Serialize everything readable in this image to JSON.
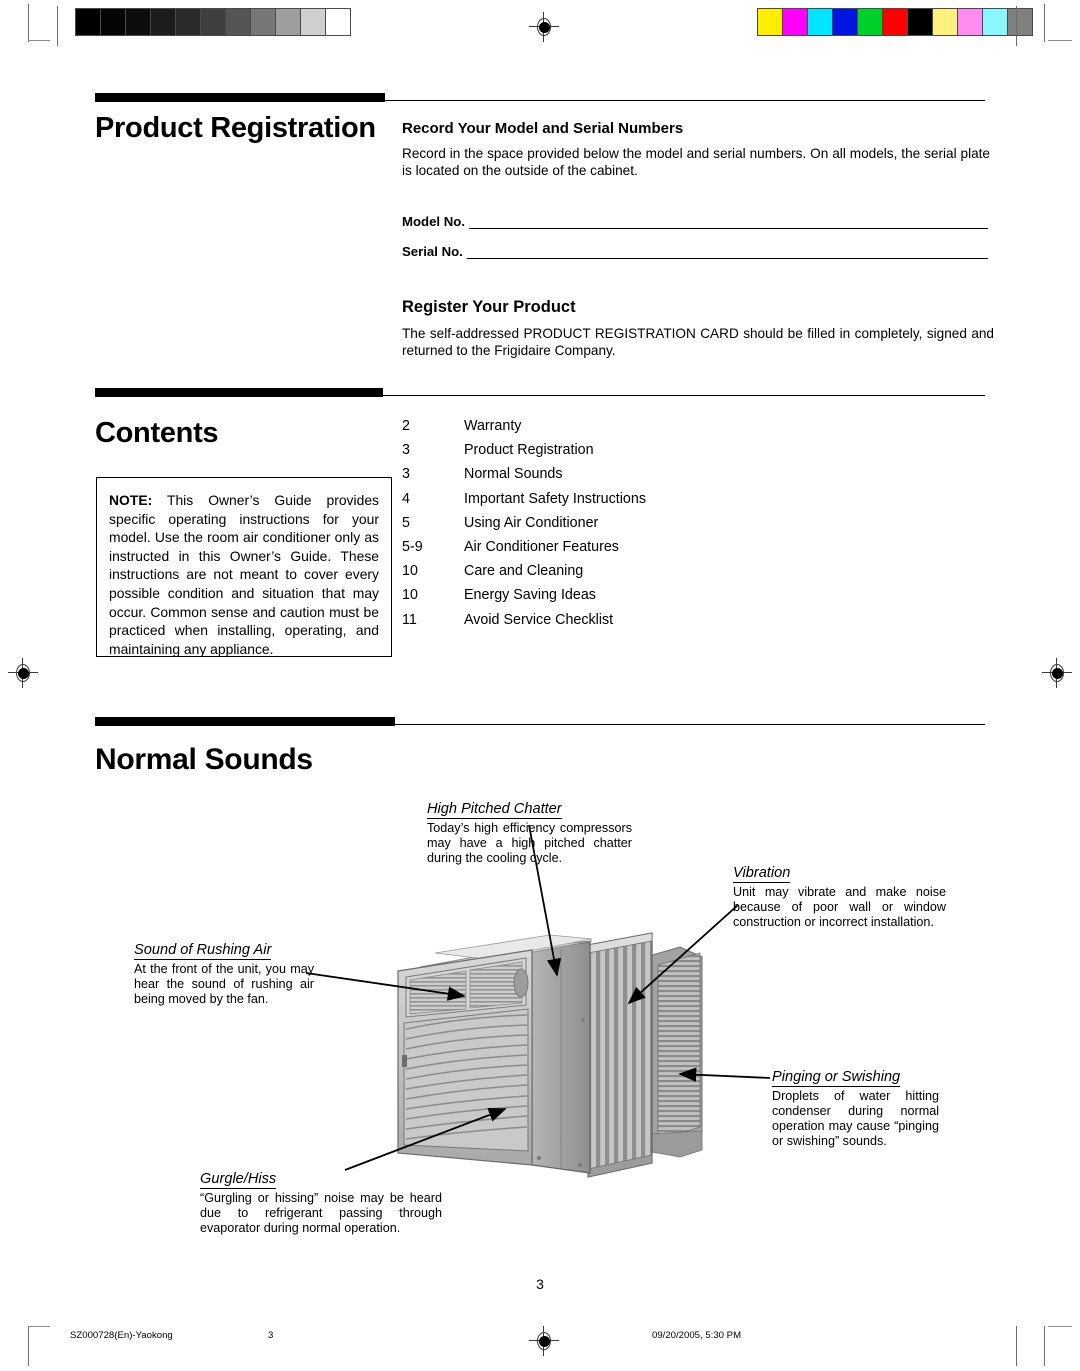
{
  "calibration": {
    "gray_swatches": [
      "#000000",
      "#050505",
      "#0d0d0d",
      "#1c1c1c",
      "#2b2b2b",
      "#3e3e3e",
      "#555555",
      "#777777",
      "#9e9e9e",
      "#cfcfcf",
      "#ffffff"
    ],
    "color_swatches": [
      "#ffee00",
      "#ff00ff",
      "#00e5ff",
      "#0015e0",
      "#00d02a",
      "#ff0000",
      "#000000",
      "#fff07f",
      "#ff8cf0",
      "#8cf6ff",
      "#808080"
    ],
    "registration_mark": "registration-target-icon"
  },
  "product_registration": {
    "title": "Product Registration",
    "record_heading": "Record Your Model and Serial Numbers",
    "record_body": "Record in the space provided below the model and serial numbers. On all models, the serial plate is located on the outside of the cabinet.",
    "fields": [
      {
        "label": "Model No.",
        "value": ""
      },
      {
        "label": "Serial No.",
        "value": ""
      }
    ],
    "register_heading": "Register Your Product",
    "register_body": "The self-addressed PRODUCT REGISTRATION CARD should be filled in completely, signed and returned to the Frigidaire Company."
  },
  "contents": {
    "title": "Contents",
    "note": {
      "lead": "NOTE:",
      "text": " This Owner’s Guide provides specific operating instructions for your model. Use the room air conditioner only as instructed in this Owner’s Guide. These instructions are not meant to cover every possible condition and situation that may occur. Common sense and caution must be practiced when installing, operating, and maintaining any appliance."
    },
    "entries": [
      {
        "page": "2",
        "label": "Warranty"
      },
      {
        "page": "3",
        "label": "Product Registration"
      },
      {
        "page": "3",
        "label": "Normal Sounds"
      },
      {
        "page": "4",
        "label": "Important Safety Instructions"
      },
      {
        "page": "5",
        "label": "Using Air Conditioner"
      },
      {
        "page": "5-9",
        "label": "Air Conditioner Features"
      },
      {
        "page": "10",
        "label": "Care and Cleaning"
      },
      {
        "page": "10",
        "label": "Energy Saving Ideas"
      },
      {
        "page": "11",
        "label": "Avoid Service Checklist"
      }
    ]
  },
  "normal_sounds": {
    "title": "Normal Sounds",
    "illustration_name": "window-air-conditioner-illustration",
    "callouts": [
      {
        "id": "high-pitched-chatter",
        "title": "High Pitched Chatter",
        "body": "Today’s high efficiency compressors may have a high pitched chatter during the cooling cycle."
      },
      {
        "id": "vibration",
        "title": "Vibration",
        "body": "Unit may vibrate and make noise because of poor wall or window construction or incorrect installation."
      },
      {
        "id": "sound-of-rushing-air",
        "title": "Sound of Rushing Air",
        "body": "At the front of the unit, you may hear the sound of rushing air being moved by the fan."
      },
      {
        "id": "pinging-or-swishing",
        "title": "Pinging or Swishing",
        "body": "Droplets of water hitting condenser during normal operation may cause “pinging or swishing” sounds."
      },
      {
        "id": "gurgle-hiss",
        "title": "Gurgle/Hiss",
        "body": "“Gurgling or hissing” noise may be heard due to refrigerant passing through evaporator during normal operation."
      }
    ]
  },
  "page_number": "3",
  "footer": {
    "document_id": "SZ000728(En)-Yaokong",
    "page": "3",
    "timestamp": "09/20/2005, 5:30 PM"
  }
}
